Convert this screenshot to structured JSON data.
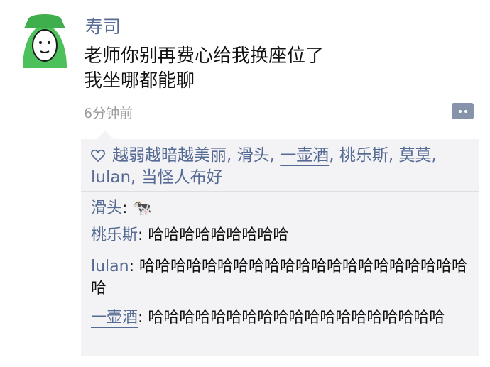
{
  "post": {
    "author": "寿司",
    "lines": [
      "老师你别再费心给我换座位了",
      "我坐哪都能聊"
    ],
    "time": "6分钟前"
  },
  "likes": {
    "names": [
      "越弱越暗越美丽",
      "滑头",
      "一壶酒",
      "桃乐斯",
      "莫莫",
      "lulan",
      "当怪人布好"
    ]
  },
  "comments": [
    {
      "name": "滑头",
      "text": "🐄"
    },
    {
      "name": "桃乐斯",
      "text": "哈哈哈哈哈哈哈哈哈"
    },
    {
      "name": "lulan",
      "text": "哈哈哈哈哈哈哈哈哈哈哈哈哈哈哈哈哈哈哈哈哈哈"
    },
    {
      "name": "一壶酒",
      "text": "哈哈哈哈哈哈哈哈哈哈哈哈哈哈哈哈哈哈哈"
    }
  ],
  "colors": {
    "link": "#566b94",
    "panel": "#f3f3f5",
    "avatar_green": "#4cc05a"
  }
}
